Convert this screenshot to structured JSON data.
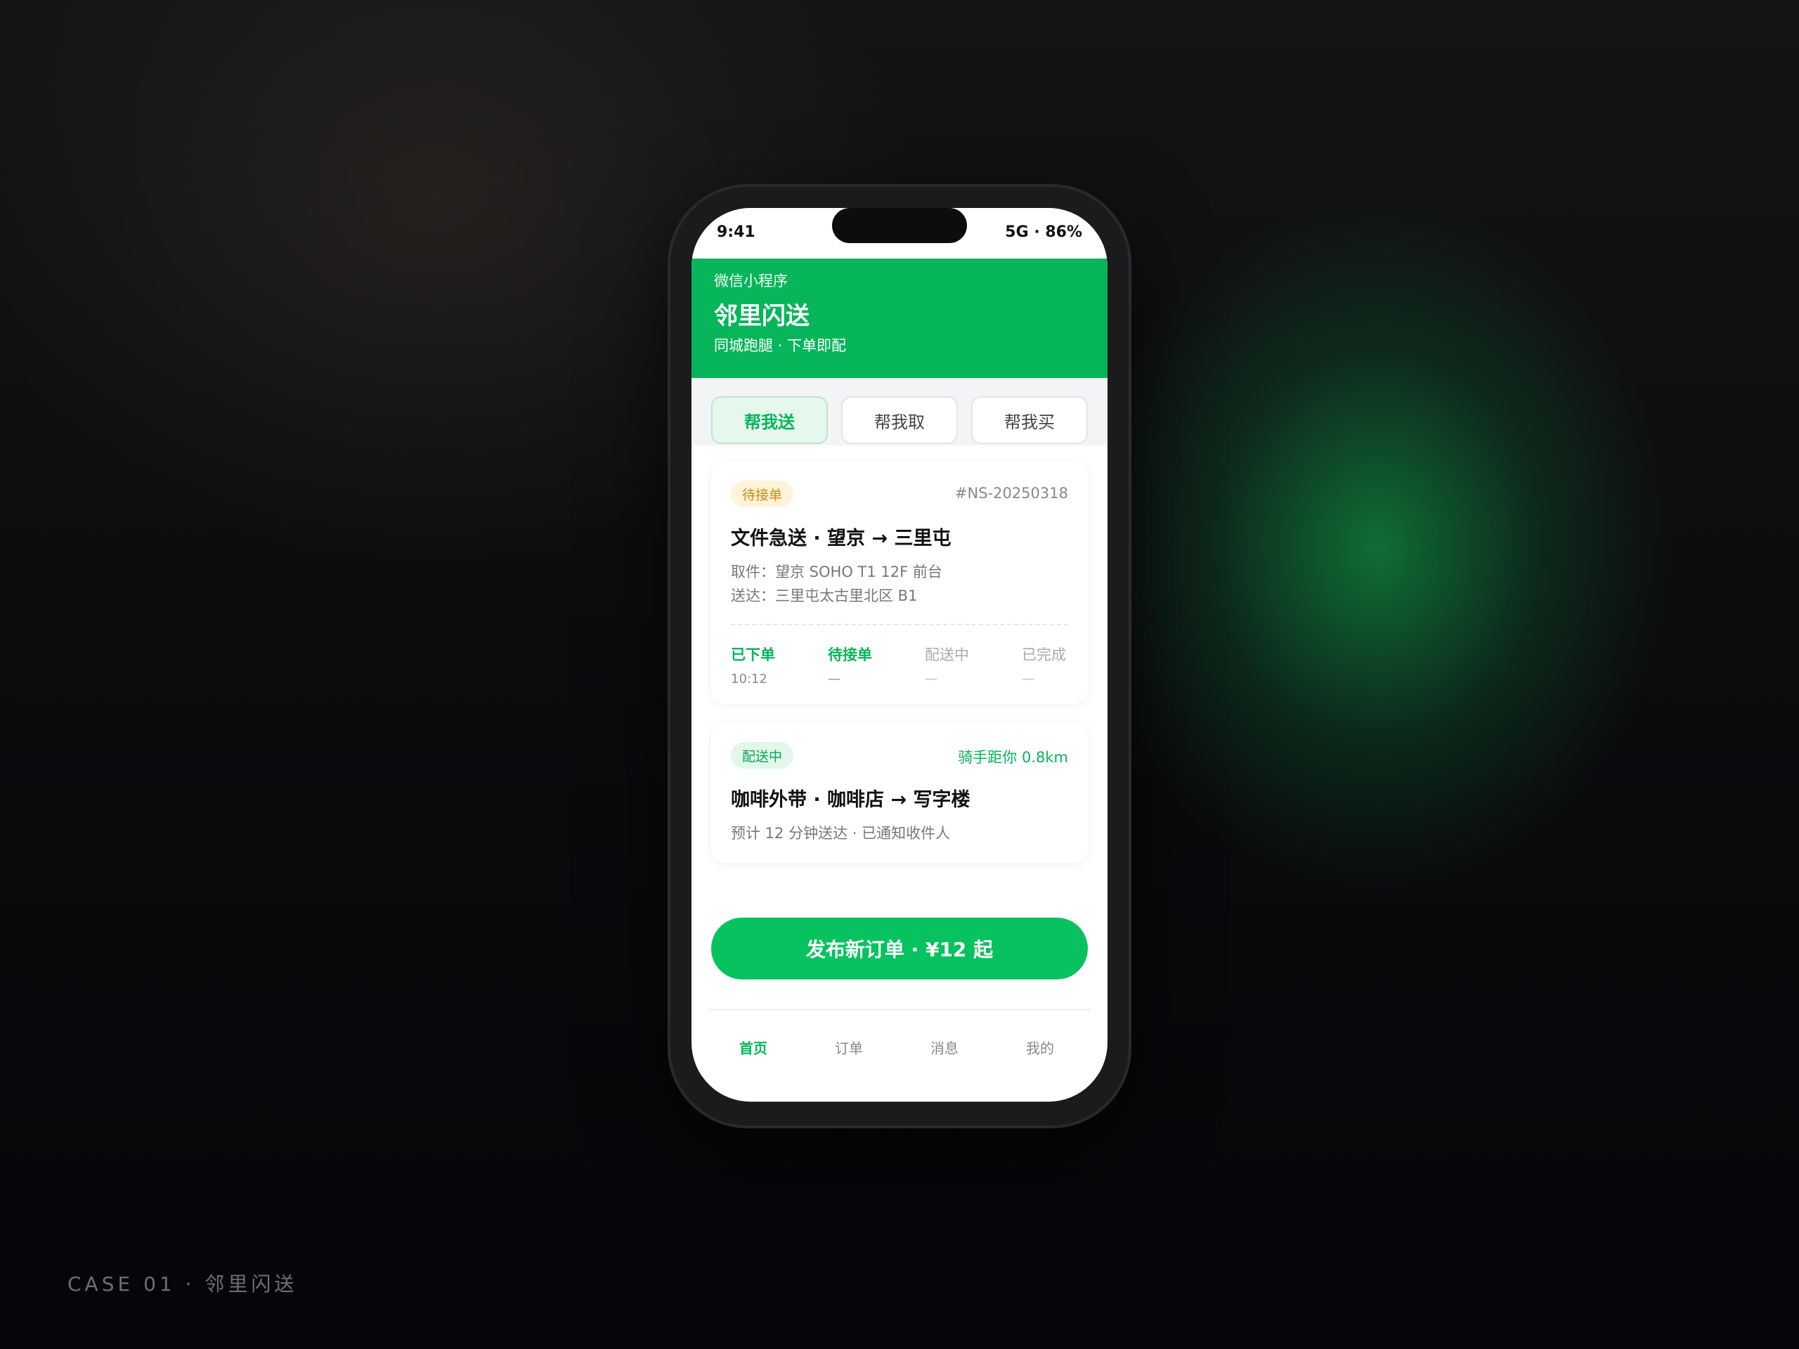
{
  "case_label": "CASE 01 · 邻里闪送",
  "status_bar": {
    "time": "9:41",
    "network": "5G · 86%"
  },
  "header": {
    "mini_program": "微信小程序",
    "app_title": "邻里闪送",
    "subtitle": "同城跑腿 · 下单即配"
  },
  "service_tabs": [
    {
      "label": "帮我送",
      "active": true
    },
    {
      "label": "帮我取",
      "active": false
    },
    {
      "label": "帮我买",
      "active": false
    }
  ],
  "orders": [
    {
      "status": "待接单",
      "order_id": "#NS-20250318",
      "title": "文件急送 · 望京 → 三里屯",
      "pickup": "取件：望京 SOHO T1 12F 前台",
      "dropoff": "送达：三里屯太古里北区 B1",
      "steps": [
        {
          "name": "已下单",
          "time": "10:12"
        },
        {
          "name": "待接单",
          "time": "—"
        },
        {
          "name": "配送中",
          "time": "—"
        },
        {
          "name": "已完成",
          "time": "—"
        }
      ]
    },
    {
      "status": "配送中",
      "rider_distance": "骑手距你 0.8km",
      "title": "咖啡外带 · 咖啡店 → 写字楼",
      "eta": "预计 12 分钟送达 · 已通知收件人"
    }
  ],
  "cta_label": "发布新订单 · ¥12 起",
  "bottom_nav": [
    {
      "label": "首页",
      "active": true
    },
    {
      "label": "订单",
      "active": false
    },
    {
      "label": "消息",
      "active": false
    },
    {
      "label": "我的",
      "active": false
    }
  ],
  "colors": {
    "brand_green": "#07b55a",
    "pending_orange": "#d28a0b"
  }
}
